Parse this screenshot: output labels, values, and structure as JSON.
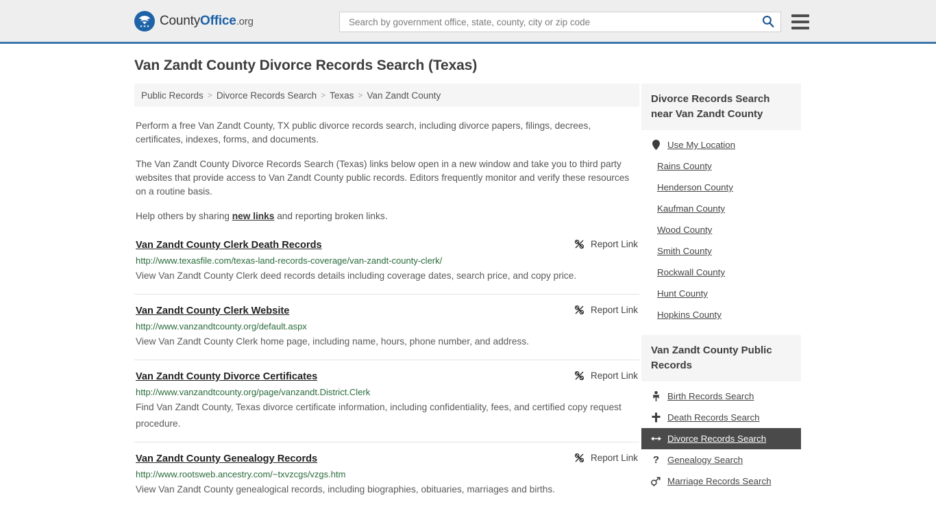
{
  "header": {
    "logo": {
      "icon": "eagle-shield-emblem",
      "text_county": "County",
      "text_office": "Office",
      "text_tld": ".org"
    },
    "search": {
      "placeholder": "Search by government office, state, county, city or zip code",
      "value": "",
      "icon": "search-icon"
    },
    "menu_icon": "hamburger-menu-icon"
  },
  "page_title": "Van Zandt County Divorce Records Search (Texas)",
  "breadcrumb": {
    "separator": ">",
    "items": [
      {
        "label": "Public Records"
      },
      {
        "label": "Divorce Records Search"
      },
      {
        "label": "Texas"
      },
      {
        "label": "Van Zandt County"
      }
    ]
  },
  "intro": {
    "p1": "Perform a free Van Zandt County, TX public divorce records search, including divorce papers, filings, decrees, certificates, indexes, forms, and documents.",
    "p2": "The Van Zandt County Divorce Records Search (Texas) links below open in a new window and take you to third party websites that provide access to Van Zandt County public records. Editors frequently monitor and verify these resources on a routine basis.",
    "p3_before": "Help others by sharing ",
    "p3_link": "new links",
    "p3_after": " and reporting broken links."
  },
  "report_link_label": "Report Link",
  "report_link_icon": "broken-link-icon",
  "results": [
    {
      "title": "Van Zandt County Clerk Death Records",
      "url": "http://www.texasfile.com/texas-land-records-coverage/van-zandt-county-clerk/",
      "description": "View Van Zandt County Clerk deed records details including coverage dates, search price, and copy price."
    },
    {
      "title": "Van Zandt County Clerk Website",
      "url": "http://www.vanzandtcounty.org/default.aspx",
      "description": "View Van Zandt County Clerk home page, including name, hours, phone number, and address."
    },
    {
      "title": "Van Zandt County Divorce Certificates",
      "url": "http://www.vanzandtcounty.org/page/vanzandt.District.Clerk",
      "description": "Find Van Zandt County, Texas divorce certificate information, including confidentiality, fees, and certified copy request procedure."
    },
    {
      "title": "Van Zandt County Genealogy Records",
      "url": "http://www.rootsweb.ancestry.com/~txvzcgs/vzgs.htm",
      "description": "View Van Zandt County genealogical records, including biographies, obituaries, marriages and births."
    }
  ],
  "sidebar": {
    "nearby": {
      "heading": "Divorce Records Search near Van Zandt County",
      "items": [
        {
          "label": "Use My Location",
          "icon": "map-pin-icon",
          "active": false
        },
        {
          "label": "Rains County",
          "icon": "",
          "active": false
        },
        {
          "label": "Henderson County",
          "icon": "",
          "active": false
        },
        {
          "label": "Kaufman County",
          "icon": "",
          "active": false
        },
        {
          "label": "Wood County",
          "icon": "",
          "active": false
        },
        {
          "label": "Smith County",
          "icon": "",
          "active": false
        },
        {
          "label": "Rockwall County",
          "icon": "",
          "active": false
        },
        {
          "label": "Hunt County",
          "icon": "",
          "active": false
        },
        {
          "label": "Hopkins County",
          "icon": "",
          "active": false
        }
      ]
    },
    "public_records": {
      "heading": "Van Zandt County Public Records",
      "items": [
        {
          "label": "Birth Records Search",
          "icon": "baby-icon",
          "active": false
        },
        {
          "label": "Death Records Search",
          "icon": "cross-icon",
          "active": false
        },
        {
          "label": "Divorce Records Search",
          "icon": "arrows-left-right-icon",
          "active": true
        },
        {
          "label": "Genealogy Search",
          "icon": "question-mark-icon",
          "active": false
        },
        {
          "label": "Marriage Records Search",
          "icon": "mars-venus-icon",
          "active": false
        }
      ]
    }
  },
  "colors": {
    "header_bg": "#eeeeee",
    "header_border": "#3b77ad",
    "url_green": "#2a6b3c",
    "active_bg": "#4a4a4a",
    "panel_bg": "#f5f5f5",
    "brand_blue": "#1e62a8"
  }
}
